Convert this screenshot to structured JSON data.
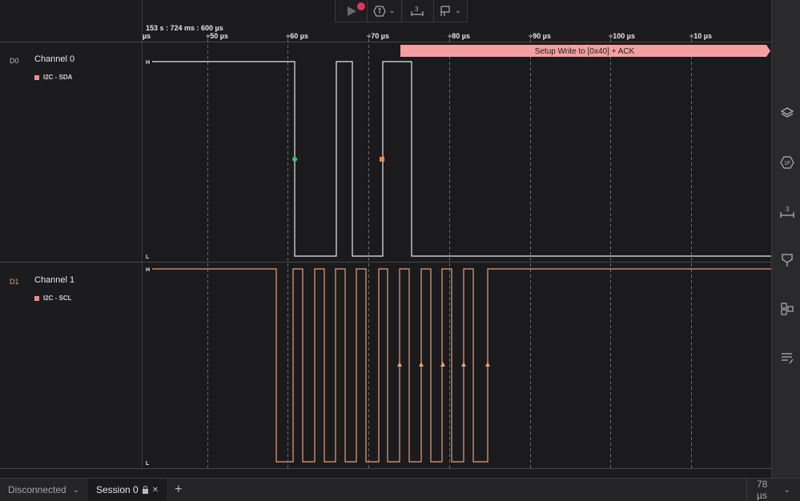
{
  "timeline": {
    "origin_label": "153 s : 724 ms : 600 µs",
    "edge_label": "µs",
    "ticks": [
      "+50 µs",
      "+60 µs",
      "+70 µs",
      "+80 µs",
      "+90 µs",
      "+100 µs",
      "+10 µs"
    ]
  },
  "channels": [
    {
      "id": "D0",
      "name": "Channel 0",
      "analyzer": "I2C - SDA",
      "high_label": "H",
      "low_label": "L",
      "color": "#e8e8e8"
    },
    {
      "id": "D1",
      "name": "Channel 1",
      "analyzer": "I2C - SCL",
      "high_label": "H",
      "low_label": "L",
      "color": "#e8a07a"
    }
  ],
  "decode": {
    "text": "Setup Write to [0x40] + ACK",
    "color": "#f4a0a0"
  },
  "toolbar": {
    "play_icon": "play-icon",
    "record_indicator_color": "#e0355a",
    "trigger_icon": "trigger-icon",
    "measure_icon": "measure-icon",
    "measure_badge": "3",
    "marker_icon": "marker-icon"
  },
  "sidebar": {
    "icons": [
      "layers-icon",
      "analyzer-icon",
      "measurement-icon",
      "marker-icon",
      "extensions-icon",
      "notes-icon"
    ],
    "measure_badge": "3"
  },
  "status_bar": {
    "connection": "Disconnected",
    "session": "Session 0",
    "add_label": "+",
    "timescale": "78 µs"
  }
}
